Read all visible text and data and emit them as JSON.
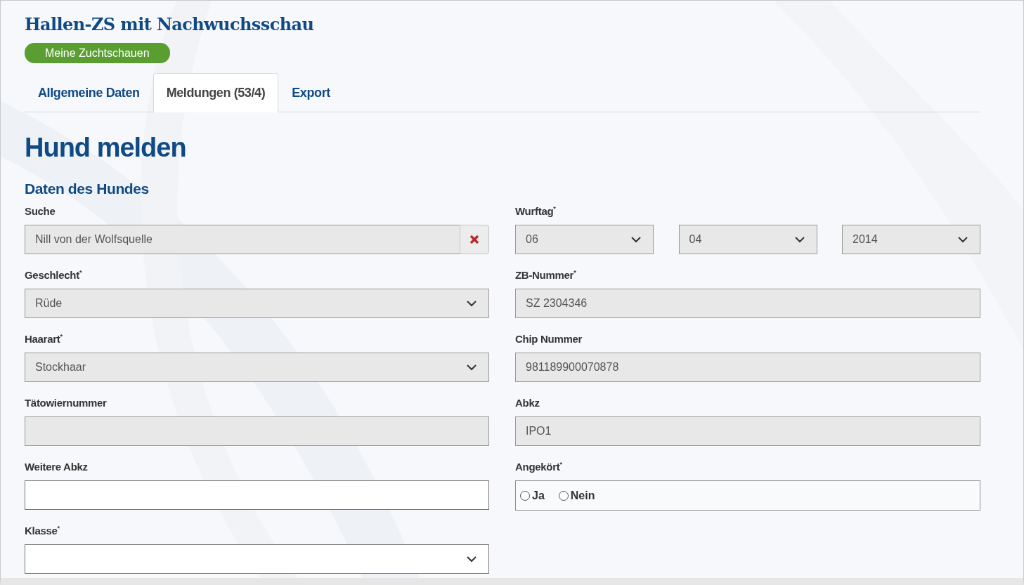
{
  "title": "Hallen-ZS mit Nachwuchsschau",
  "nav_button": "Meine Zuchtschauen",
  "tabs": [
    {
      "label": "Allgemeine Daten",
      "selected": false
    },
    {
      "label": "Meldungen (53/4)",
      "selected": true
    },
    {
      "label": "Export",
      "selected": false
    }
  ],
  "heading": "Hund melden",
  "section": "Daten des Hundes",
  "left_fields": [
    {
      "kind": "search",
      "label": "Suche",
      "value": "Nill von der Wolfsquelle",
      "readonly": true
    },
    {
      "kind": "select",
      "label": "Geschlecht$^{*}$",
      "value": "Rüde",
      "readonly": true
    },
    {
      "kind": "select",
      "label": "Haarart$^{*}$",
      "value": "Stockhaar",
      "readonly": true
    },
    {
      "kind": "text",
      "label": "Tätowiernummer",
      "readonly": true
    },
    {
      "kind": "text",
      "label": "Weitere Abkz",
      "readonly": false
    },
    {
      "kind": "select",
      "label": "Klasse$^{*}$",
      "readonly": false
    }
  ],
  "right_fields": [
    {
      "kind": "date",
      "label": "Wurftag$^{*}$",
      "parts": [
        "06",
        "04",
        "2014"
      ],
      "readonly": true
    },
    {
      "kind": "text",
      "label": "ZB-Nummer$^{*}$",
      "value": "SZ 2304346",
      "readonly": true
    },
    {
      "kind": "text",
      "label": "Chip Nummer",
      "value": "981189900070878",
      "readonly": true
    },
    {
      "kind": "text",
      "label": "Abkz",
      "value": "IPO1",
      "readonly": true
    },
    {
      "kind": "radio",
      "label": "Angekört$^{*}$",
      "options": [
        {
          "label": "Ja",
          "selected": false
        },
        {
          "label": "Nein",
          "selected": false
        }
      ]
    }
  ]
}
